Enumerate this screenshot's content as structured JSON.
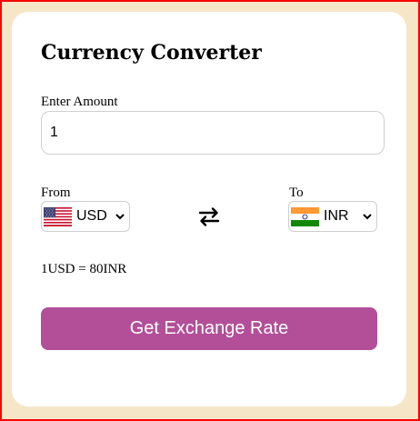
{
  "app": {
    "title": "Currency Converter"
  },
  "amount": {
    "label": "Enter Amount",
    "value": "1"
  },
  "from": {
    "label": "From",
    "selected": "USD",
    "flag_icon": "us-flag-icon"
  },
  "to": {
    "label": "To",
    "selected": "INR",
    "flag_icon": "india-flag-icon"
  },
  "swap": {
    "icon": "swap-arrows-icon"
  },
  "result": {
    "text": "1USD = 80INR"
  },
  "button": {
    "label": "Get Exchange Rate"
  },
  "colors": {
    "page_border": "#ff0000",
    "background": "#f5e6c8",
    "card": "#ffffff",
    "button": "#b24f98",
    "button_text": "#ffffff"
  }
}
